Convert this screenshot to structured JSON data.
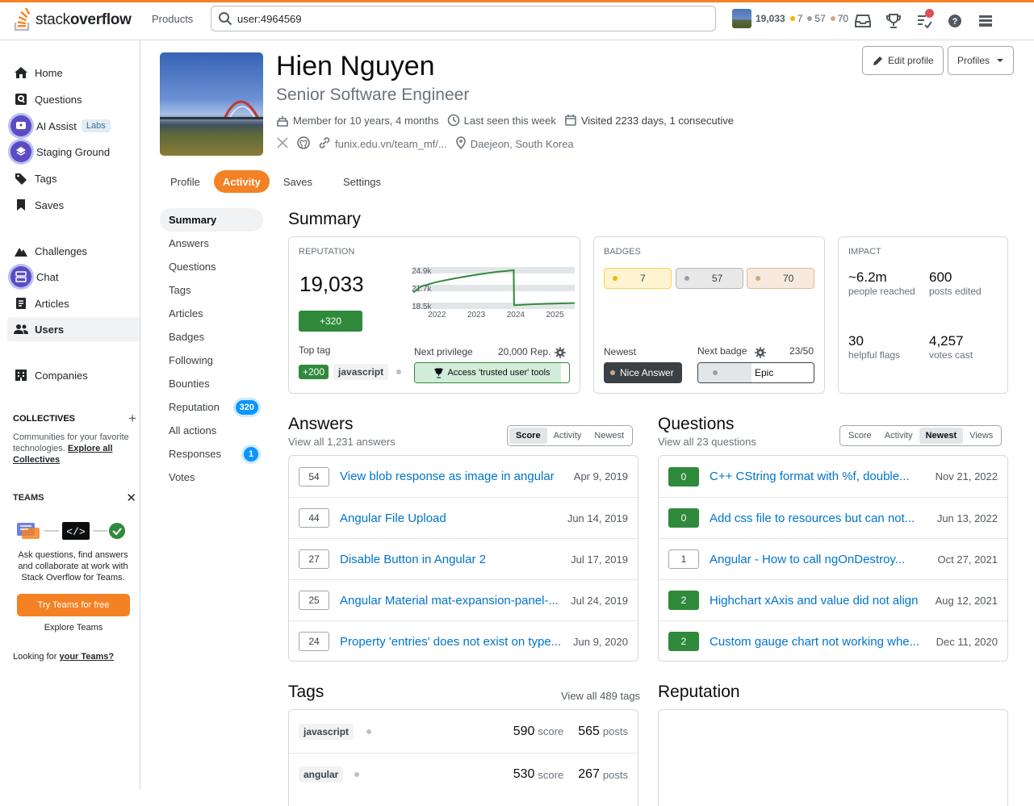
{
  "topbar": {
    "logo_text_light": "stack",
    "logo_text_bold": "overflow",
    "products": "Products",
    "search_value": "user:4964569",
    "reputation": "19,033",
    "gold": "7",
    "silver": "57",
    "bronze": "70"
  },
  "sidebar": {
    "items": [
      {
        "label": "Home"
      },
      {
        "label": "Questions"
      },
      {
        "label": "AI Assist",
        "badge": "Labs"
      },
      {
        "label": "Staging Ground"
      },
      {
        "label": "Tags"
      },
      {
        "label": "Saves"
      },
      {
        "label": "Challenges"
      },
      {
        "label": "Chat"
      },
      {
        "label": "Articles"
      },
      {
        "label": "Users"
      },
      {
        "label": "Companies"
      }
    ],
    "collectives_title": "COLLECTIVES",
    "collectives_text": "Communities for your favorite technologies.",
    "collectives_link": "Explore all Collectives",
    "teams_title": "TEAMS",
    "teams_text": "Ask questions, find answers and collaborate at work with Stack Overflow for Teams.",
    "teams_button": "Try Teams for free",
    "teams_explore": "Explore Teams",
    "teams_looking": "Looking for",
    "teams_looking_link": "your Teams?"
  },
  "profile": {
    "name": "Hien Nguyen",
    "title": "Senior Software Engineer",
    "member": "Member for 10 years, 4 months",
    "last_seen": "Last seen this week",
    "visited": "Visited 2233 days, 1 consecutive",
    "website": "funix.edu.vn/team_mf/...",
    "location": "Daejeon, South Korea",
    "edit_button": "Edit profile",
    "profiles_button": "Profiles"
  },
  "tabs": [
    "Profile",
    "Activity",
    "Saves",
    "Settings"
  ],
  "subnav": [
    {
      "label": "Summary"
    },
    {
      "label": "Answers"
    },
    {
      "label": "Questions"
    },
    {
      "label": "Tags"
    },
    {
      "label": "Articles"
    },
    {
      "label": "Badges"
    },
    {
      "label": "Following"
    },
    {
      "label": "Bounties"
    },
    {
      "label": "Reputation",
      "count": "320"
    },
    {
      "label": "All actions"
    },
    {
      "label": "Responses",
      "count": "1"
    },
    {
      "label": "Votes"
    }
  ],
  "summary": {
    "heading": "Summary",
    "reputation": {
      "caption": "REPUTATION",
      "value": "19,033",
      "change": "+320",
      "top_tag_label": "Top tag",
      "top_tag_score": "+200",
      "top_tag": "javascript",
      "next_privilege_label": "Next privilege",
      "next_privilege_rep": "20,000 Rep.",
      "next_privilege_button": "Access 'trusted user' tools"
    },
    "badges": {
      "caption": "BADGES",
      "gold": "7",
      "silver": "57",
      "bronze": "70",
      "newest_label": "Newest",
      "newest_badge": "Nice Answer",
      "next_badge_label": "Next badge",
      "next_badge_progress": "23/50",
      "next_badge": "Epic"
    },
    "impact": {
      "caption": "IMPACT",
      "reached": "~6.2m",
      "reached_label": "people reached",
      "edited": "600",
      "edited_label": "posts edited",
      "flags": "30",
      "flags_label": "helpful flags",
      "votes": "4,257",
      "votes_label": "votes cast"
    }
  },
  "chart_data": {
    "type": "line",
    "x": [
      2021.4,
      2021.6,
      2022.0,
      2022.5,
      2023.0,
      2023.5,
      2023.95,
      2023.96,
      2024.5,
      2025.0,
      2025.5
    ],
    "values": [
      20.9,
      22.0,
      22.8,
      23.5,
      24.1,
      24.6,
      24.9,
      18.6,
      18.8,
      18.9,
      19.0
    ],
    "y_ticks": [
      "24.9k",
      "21.7k",
      "18.5k"
    ],
    "x_ticks": [
      "2022",
      "2023",
      "2024",
      "2025"
    ],
    "ylim": [
      18.5,
      24.9
    ],
    "color": "#2f8a3b"
  },
  "answers": {
    "heading": "Answers",
    "sub": "View all 1,231 answers",
    "sorts": [
      "Score",
      "Activity",
      "Newest"
    ],
    "rows": [
      {
        "score": "54",
        "title": "View blob response as image in angular",
        "date": "Apr 9, 2019"
      },
      {
        "score": "44",
        "title": "Angular File Upload",
        "date": "Jun 14, 2019"
      },
      {
        "score": "27",
        "title": "Disable Button in Angular 2",
        "date": "Jul 17, 2019"
      },
      {
        "score": "25",
        "title": "Angular Material mat-expansion-panel-...",
        "date": "Jul 24, 2019"
      },
      {
        "score": "24",
        "title": "Property 'entries' does not exist on type...",
        "date": "Jun 9, 2020"
      }
    ]
  },
  "questions": {
    "heading": "Questions",
    "sub": "View all 23 questions",
    "sorts": [
      "Score",
      "Activity",
      "Newest",
      "Views"
    ],
    "rows": [
      {
        "score": "0",
        "title": "C++ CString format with %f, double...",
        "date": "Nov 21, 2022"
      },
      {
        "score": "0",
        "title": "Add css file to resources but can not...",
        "date": "Jun 13, 2022"
      },
      {
        "score": "1",
        "title": "Angular - How to call ngOnDestroy...",
        "date": "Oct 27, 2021"
      },
      {
        "score": "2",
        "title": "Highchart xAxis and value did not align",
        "date": "Aug 12, 2021"
      },
      {
        "score": "2",
        "title": "Custom gauge chart not working whe...",
        "date": "Dec 11, 2020"
      }
    ]
  },
  "tags": {
    "heading": "Tags",
    "view_all": "View all 489 tags",
    "score_unit": "score",
    "posts_unit": "posts",
    "rows": [
      {
        "name": "javascript",
        "score": "590",
        "posts": "565"
      },
      {
        "name": "angular",
        "score": "530",
        "posts": "267"
      }
    ]
  },
  "reputation_section": {
    "heading": "Reputation"
  }
}
